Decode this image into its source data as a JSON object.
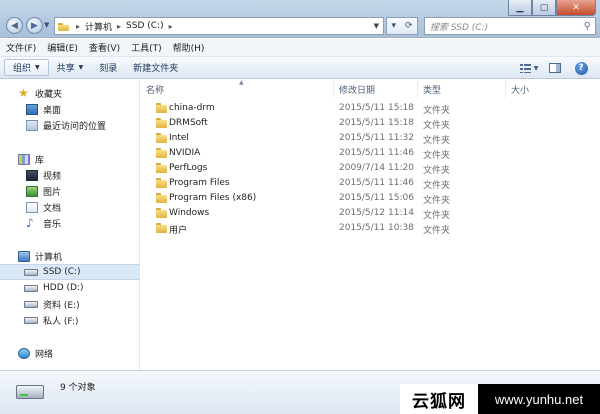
{
  "address": {
    "crumbs": [
      "计算机",
      "SSD (C:)"
    ],
    "search_placeholder": "搜索 SSD (C:)"
  },
  "menu": [
    "文件(F)",
    "编辑(E)",
    "查看(V)",
    "工具(T)",
    "帮助(H)"
  ],
  "commands": {
    "organize": "组织",
    "share": "共享",
    "burn": "刻录",
    "new_folder": "新建文件夹",
    "help_glyph": "?"
  },
  "nav": {
    "favorites": "收藏夹",
    "desktop": "桌面",
    "recent": "最近访问的位置",
    "libraries": "库",
    "videos": "视频",
    "pictures": "图片",
    "documents": "文档",
    "music": "音乐",
    "computer": "计算机",
    "drive_c": "SSD (C:)",
    "drive_d": "HDD (D:)",
    "drive_e": "资料 (E:)",
    "drive_f": "私人 (F:)",
    "network": "网络"
  },
  "columns": {
    "name": "名称",
    "date": "修改日期",
    "type": "类型",
    "size": "大小"
  },
  "files": [
    {
      "name": "china-drm",
      "date": "2015/5/11 15:18",
      "type": "文件夹"
    },
    {
      "name": "DRMSoft",
      "date": "2015/5/11 15:18",
      "type": "文件夹"
    },
    {
      "name": "Intel",
      "date": "2015/5/11 11:32",
      "type": "文件夹"
    },
    {
      "name": "NVIDIA",
      "date": "2015/5/11 11:46",
      "type": "文件夹"
    },
    {
      "name": "PerfLogs",
      "date": "2009/7/14 11:20",
      "type": "文件夹"
    },
    {
      "name": "Program Files",
      "date": "2015/5/11 11:46",
      "type": "文件夹"
    },
    {
      "name": "Program Files (x86)",
      "date": "2015/5/11 15:06",
      "type": "文件夹"
    },
    {
      "name": "Windows",
      "date": "2015/5/12 11:14",
      "type": "文件夹"
    },
    {
      "name": "用户",
      "date": "2015/5/11 10:38",
      "type": "文件夹"
    }
  ],
  "details": {
    "item_count": "9 个对象"
  },
  "watermark": {
    "site_name": "云狐网",
    "url": "www.yunhu.net"
  }
}
